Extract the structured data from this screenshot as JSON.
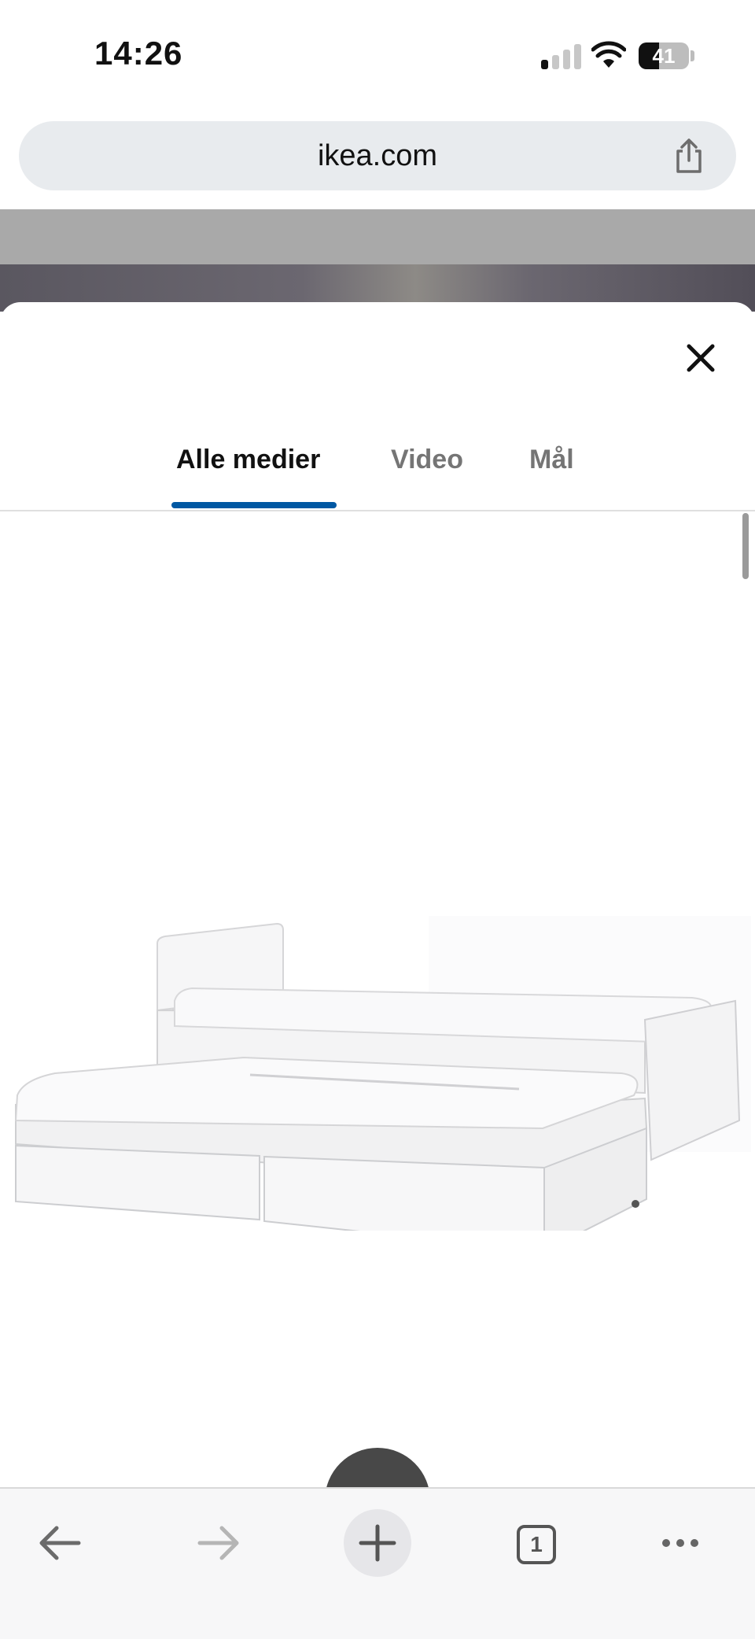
{
  "status_bar": {
    "time": "14:26",
    "battery_level": "41",
    "battery_fraction": 0.41,
    "signal_bars_active": 1,
    "signal_bars_total": 4
  },
  "browser": {
    "url": "ikea.com",
    "share_icon": "share-icon"
  },
  "media_sheet": {
    "close_icon": "close-icon",
    "tabs": [
      {
        "label": "Alle medier",
        "active": true
      },
      {
        "label": "Video",
        "active": false
      },
      {
        "label": "Mål",
        "active": false
      }
    ],
    "accent_color": "#0058a3",
    "image_subject": "white day bed with pull-out guest bed and two drawers"
  },
  "toolbar": {
    "back_icon": "arrow-left-icon",
    "forward_icon": "arrow-right-icon",
    "new_tab_icon": "plus-icon",
    "tab_count": "1",
    "more_icon": "ellipsis-icon"
  }
}
